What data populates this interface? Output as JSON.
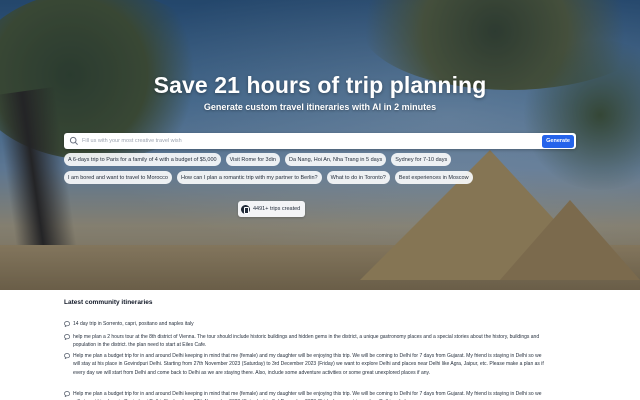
{
  "hero": {
    "title": "Save 21 hours of trip planning",
    "subtitle": "Generate custom travel itineraries with AI in 2 minutes",
    "search": {
      "placeholder": "Fill us with your most creative travel wish",
      "button_label": "Generate"
    },
    "suggestions_row1": [
      "A 6-days trip to Paris for a family of 4 with a budget of $5,000",
      "Visit Rome for 3din",
      "Da Nang, Hoi An, Nha Trang in 5 days",
      "Sydney for 7-10 days"
    ],
    "suggestions_row2": [
      "I am bored and want to travel to Morocco",
      "How can I plan a romantic trip with my partner to Berlin?",
      "What to do in Toronto?",
      "Best experiences in Moscow"
    ],
    "trips_created": "4491+ trips created"
  },
  "community": {
    "title": "Latest community itineraries",
    "items": [
      "14 day trip in Sorrento, capri, positano and naples italy",
      "help me plan a 2 hours tour at the 8th district of Vienna. The tour should include historic buildings and hidden gems in the district, a unique gastronomy places and a special stories about the history, buildings and population in the district. the plan need to start at Eiles Cafe.",
      "Help me plan a budget trip for in and around Delhi keeping in mind that me (female) and my daughter will be enjoying this trip. We will be coming to Delhi for 7 days from Gujarat. My friend is staying in Delhi so we will stay at his place in Govindpuri Delhi. Starting from 27th November 2023 (Saturday) to 3rd December 2023 (Friday) we want to explore Delhi and places near Delhi like Agra, Jaipur, etc. Please make a plan as if every day we will start from Delhi and come back to Delhi as we are staying there. Also, include some adventure activities or some great unexplored places if any.",
      "Help me plan a budget trip for in and around Delhi keeping in mind that me (female) and my daughter will be enjoying this trip. We will be coming to Delhi for 7 days from Gujarat. My friend is staying in Delhi so we will stay at his place in Govindpuri Delhi. Starting from 27th November 2023 (Saturday) to 3rd December 2023 (Friday) we want to explore Delhi and places near"
    ]
  },
  "icons": {
    "search": "search-icon",
    "badge": "map-icon",
    "item": "chat-bubble-icon"
  },
  "colors": {
    "accent": "#2563eb",
    "text": "#1f2937"
  }
}
